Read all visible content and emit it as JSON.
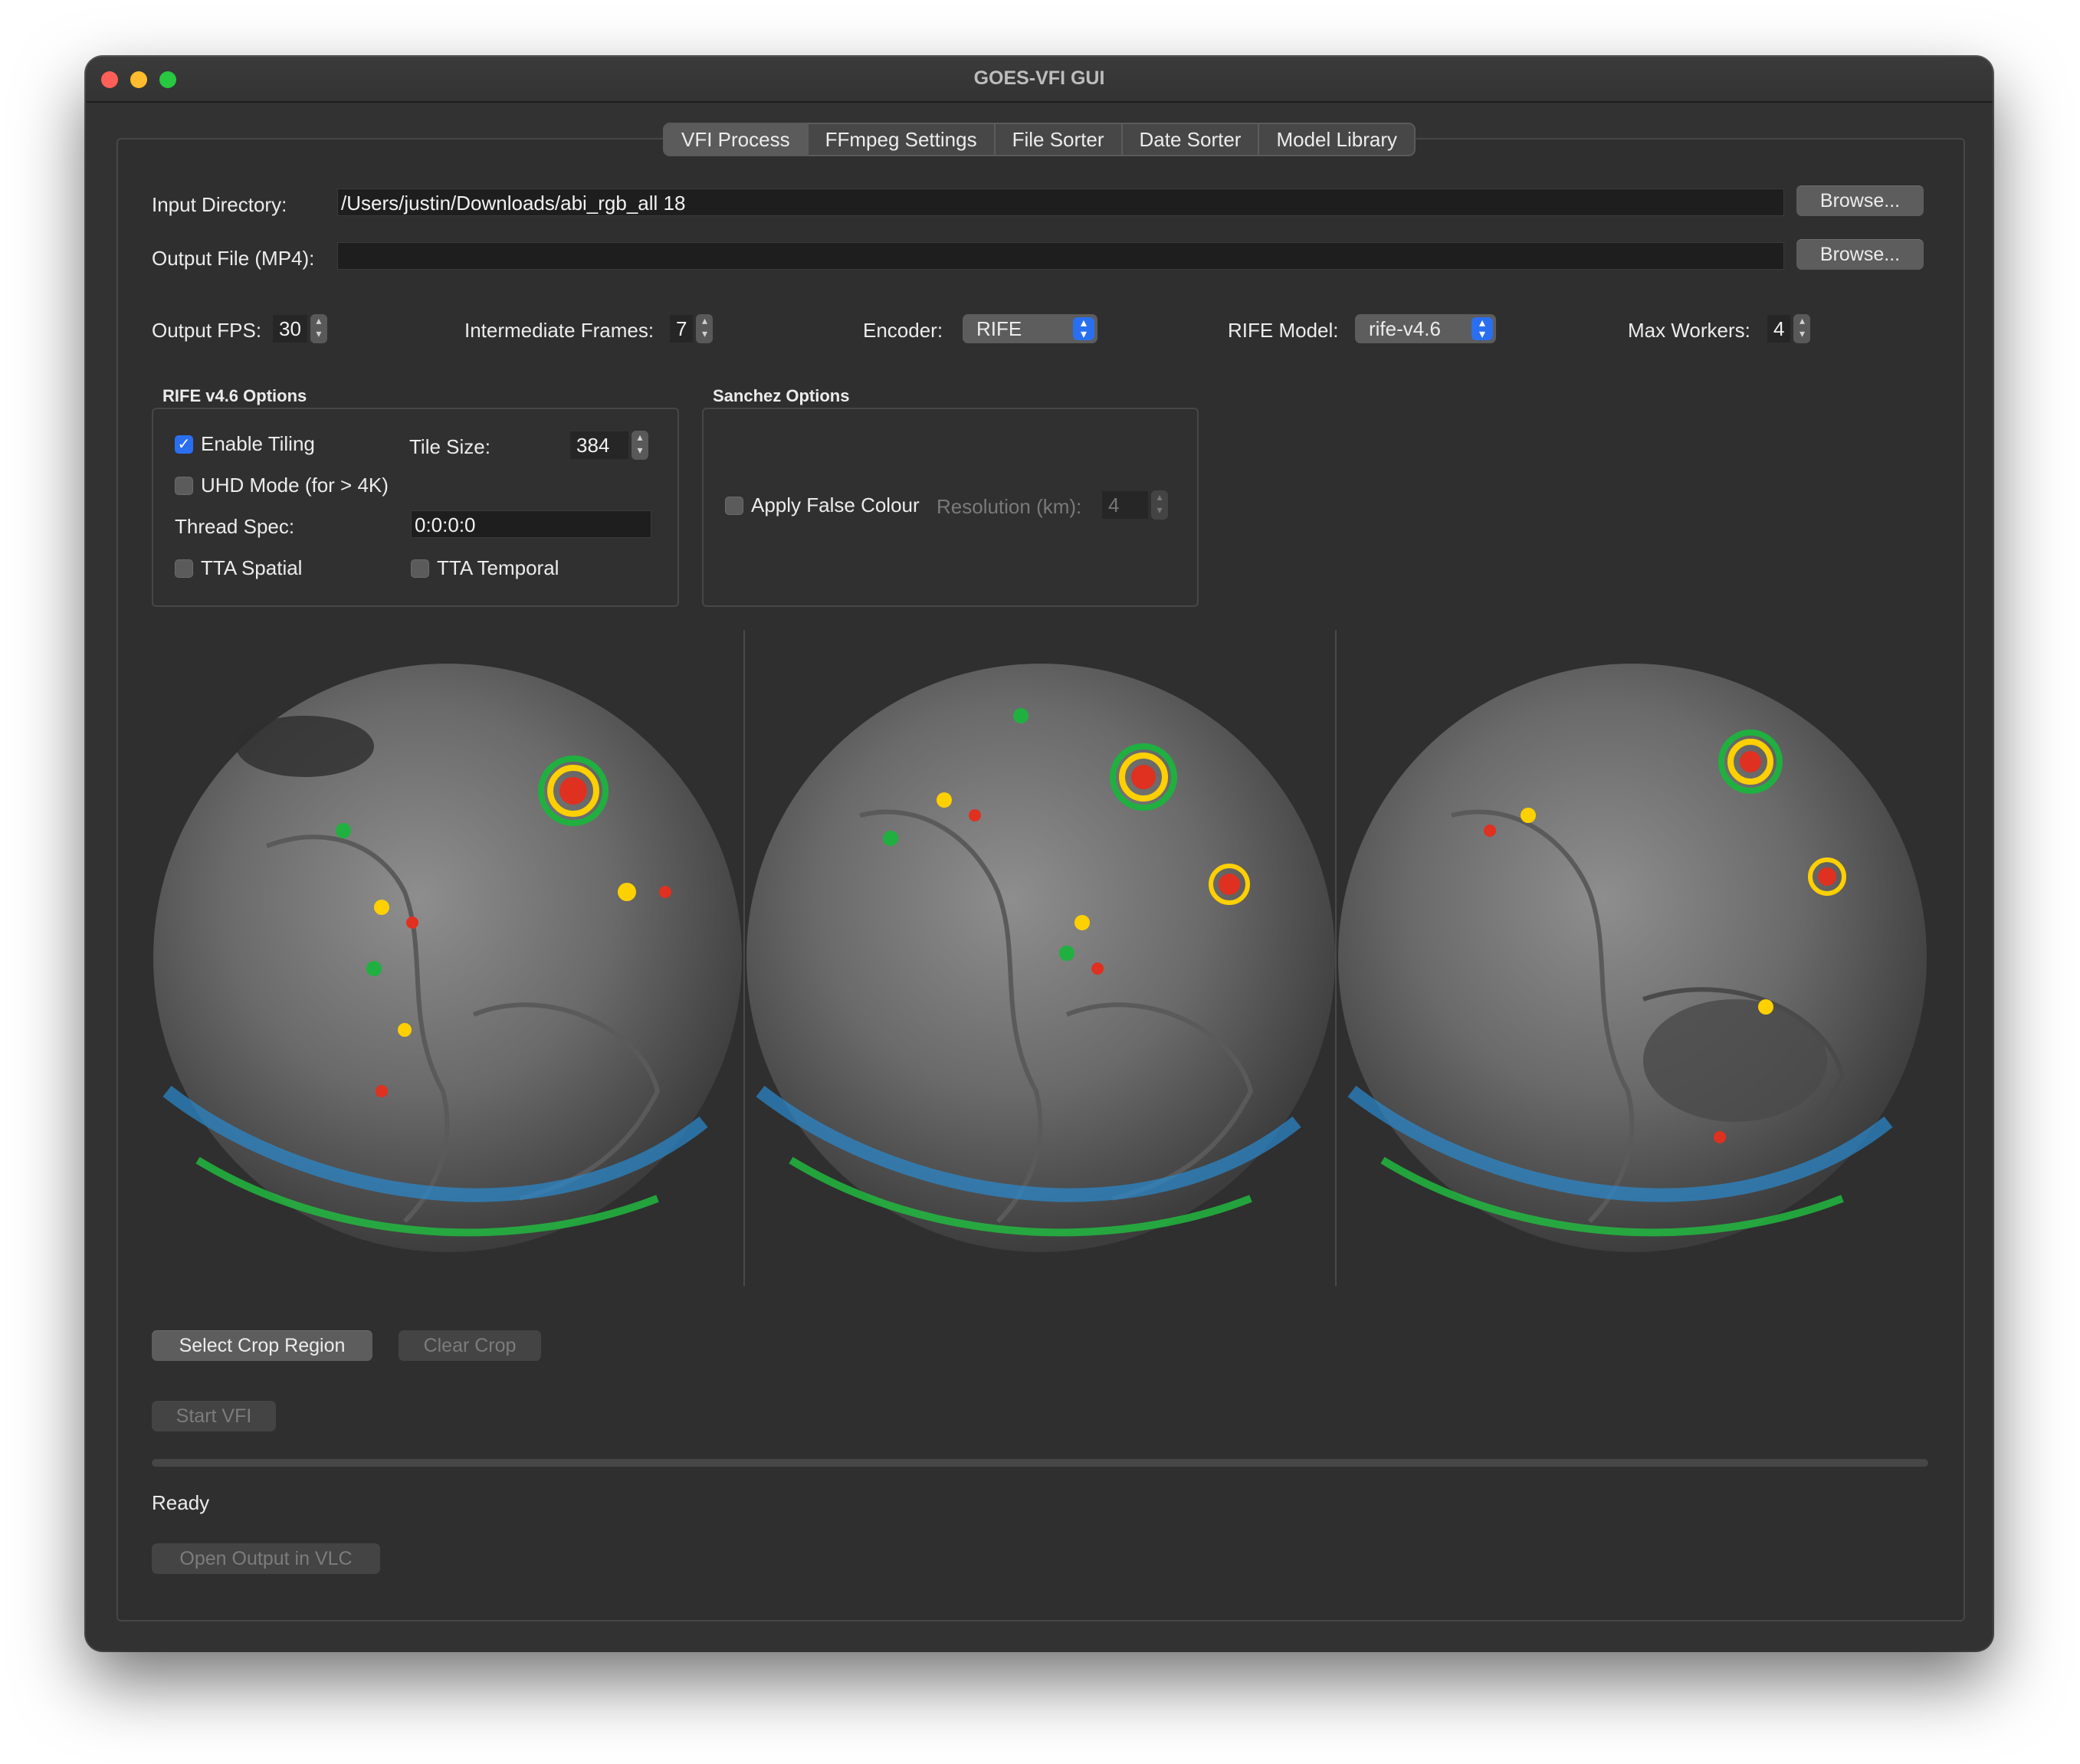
{
  "window": {
    "title": "GOES-VFI GUI"
  },
  "tabs": [
    {
      "label": "VFI Process"
    },
    {
      "label": "FFmpeg Settings"
    },
    {
      "label": "File Sorter"
    },
    {
      "label": "Date Sorter"
    },
    {
      "label": "Model Library"
    }
  ],
  "input_dir": {
    "label": "Input Directory:",
    "value": "/Users/justin/Downloads/abi_rgb_all 18",
    "browse": "Browse..."
  },
  "output_file": {
    "label": "Output File (MP4):",
    "value": "",
    "browse": "Browse..."
  },
  "settings": {
    "fps_label": "Output FPS:",
    "fps": "30",
    "frames_label": "Intermediate Frames:",
    "frames": "7",
    "encoder_label": "Encoder:",
    "encoder": "RIFE",
    "model_label": "RIFE Model:",
    "model": "rife-v4.6",
    "workers_label": "Max Workers:",
    "workers": "4"
  },
  "rife_options": {
    "title": "RIFE v4.6 Options",
    "enable_tiling": "Enable Tiling",
    "tile_size_label": "Tile Size:",
    "tile_size": "384",
    "uhd_mode": "UHD Mode (for > 4K)",
    "thread_spec_label": "Thread Spec:",
    "thread_spec": "0:0:0:0",
    "tta_spatial": "TTA Spatial",
    "tta_temporal": "TTA Temporal"
  },
  "sanchez": {
    "title": "Sanchez Options",
    "apply_false_colour": "Apply False Colour",
    "resolution_label": "Resolution (km):",
    "resolution": "4"
  },
  "previews": [
    {
      "name": "first-frame"
    },
    {
      "name": "middle-frame"
    },
    {
      "name": "last-frame"
    }
  ],
  "buttons": {
    "select_crop": "Select Crop Region",
    "clear_crop": "Clear Crop",
    "start_vfi": "Start VFI",
    "open_vlc": "Open Output in VLC"
  },
  "status": {
    "text": "Ready",
    "progress": 0
  },
  "colors": {
    "accent": "#2a6ff0",
    "background": "#323232"
  }
}
